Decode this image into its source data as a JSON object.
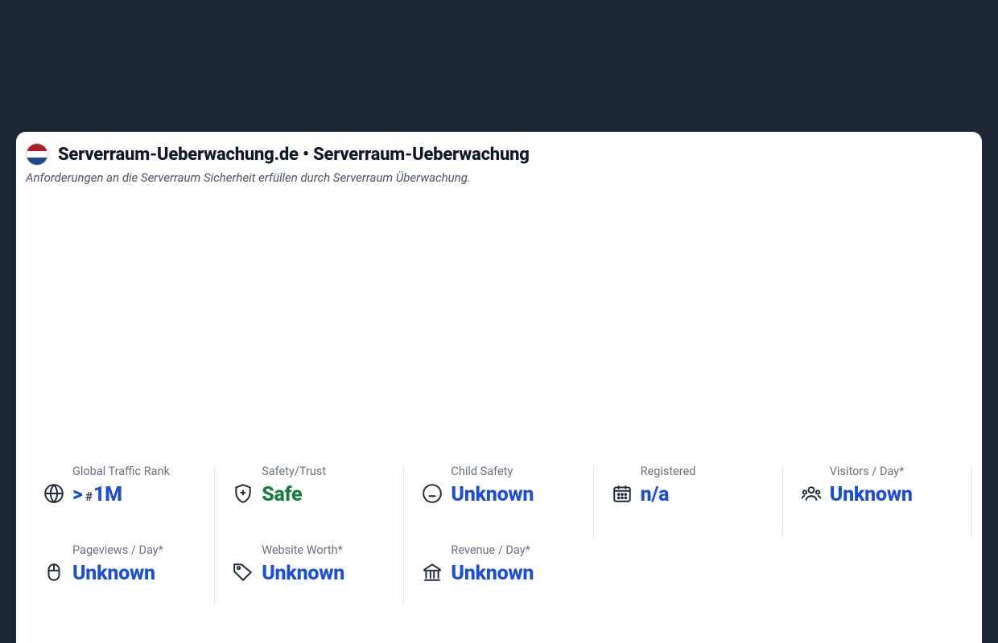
{
  "header": {
    "domain": "Serverraum-Ueberwachung.de",
    "separator": " • ",
    "site_name": "Serverraum-Ueberwachung",
    "subtitle": "Anforderungen an die Serverraum Sicherheit erfüllen durch Serverraum Überwachung.",
    "flag": "netherlands"
  },
  "stats": {
    "global_rank": {
      "label": "Global Traffic Rank",
      "prefix": ">",
      "hash": "#",
      "value": "1M"
    },
    "safety": {
      "label": "Safety/Trust",
      "value": "Safe"
    },
    "child_safety": {
      "label": "Child Safety",
      "value": "Unknown"
    },
    "registered": {
      "label": "Registered",
      "value": "n/a"
    },
    "visitors": {
      "label": "Visitors / Day*",
      "value": "Unknown"
    },
    "pageviews": {
      "label": "Pageviews / Day*",
      "value": "Unknown"
    },
    "worth": {
      "label": "Website Worth*",
      "value": "Unknown"
    },
    "revenue": {
      "label": "Revenue / Day*",
      "value": "Unknown"
    }
  }
}
